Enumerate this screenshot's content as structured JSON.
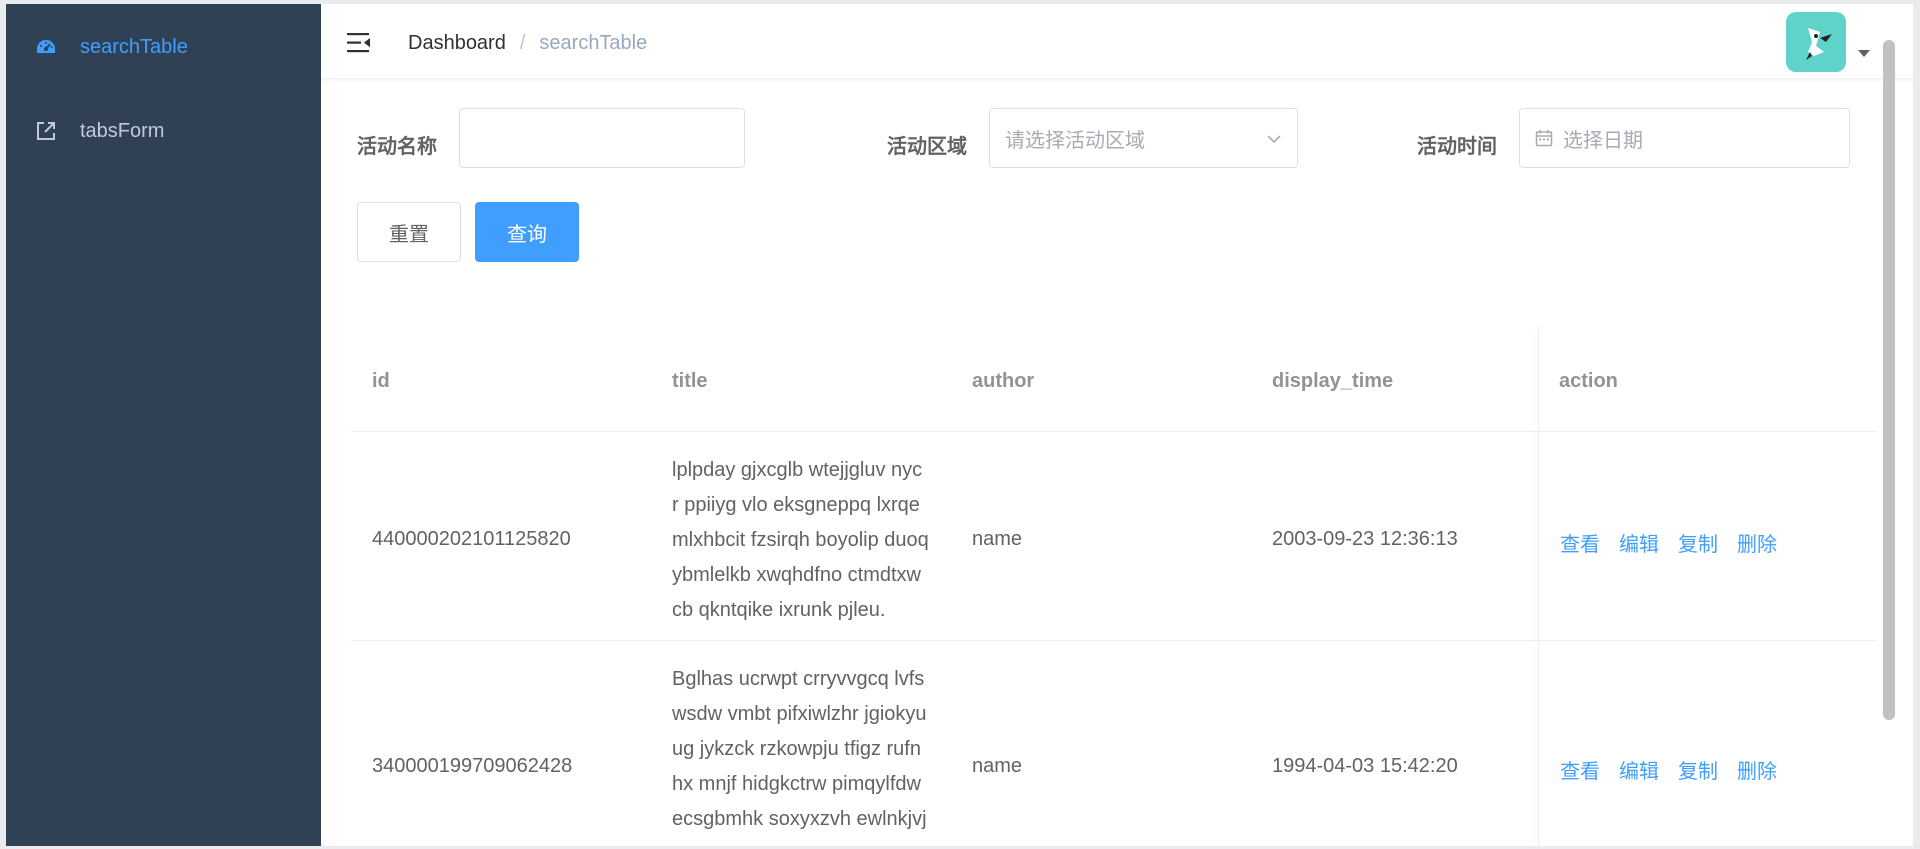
{
  "sidebar": {
    "items": [
      {
        "label": "searchTable",
        "icon": "dashboard-icon",
        "active": true
      },
      {
        "label": "tabsForm",
        "icon": "external-link-icon",
        "active": false
      }
    ]
  },
  "navbar": {
    "breadcrumb": {
      "home": "Dashboard",
      "separator": "/",
      "current": "searchTable"
    }
  },
  "filters": {
    "name_label": "活动名称",
    "name_value": "",
    "region_label": "活动区域",
    "region_placeholder": "请选择活动区域",
    "time_label": "活动时间",
    "time_placeholder": "选择日期",
    "reset_label": "重置",
    "query_label": "查询"
  },
  "table": {
    "headers": {
      "id": "id",
      "title": "title",
      "author": "author",
      "display_time": "display_time",
      "action": "action"
    },
    "actions": {
      "view": "查看",
      "edit": "编辑",
      "copy": "复制",
      "delete": "删除"
    },
    "rows": [
      {
        "id": "440000202101125820",
        "title_lines": [
          "lplpday gjxcglb wtejjgluv nyc",
          "r ppiiyg vlo eksgneppq lxrqe",
          "mlxhbcit fzsirqh boyolip duoq",
          "ybmlelkb xwqhdfno ctmdtxw",
          "cb qkntqike ixrunk pjleu."
        ],
        "author": "name",
        "display_time": "2003-09-23 12:36:13"
      },
      {
        "id": "340000199709062428",
        "title_lines": [
          "Bglhas ucrwpt crryvvgcq lvfs",
          "wsdw vmbt pifxiwlzhr jgiokyu",
          "ug jykzck rzkowpju tfigz rufn",
          "hx mnjf hidgkctrw pimqylfdw",
          "ecsgbmhk soxyxzvh ewlnkjvj"
        ],
        "author": "name",
        "display_time": "1994-04-03 15:42:20"
      }
    ]
  },
  "colors": {
    "sidebar_bg": "#304156",
    "accent": "#409eff",
    "sidebar_text": "#bfcbd9"
  }
}
